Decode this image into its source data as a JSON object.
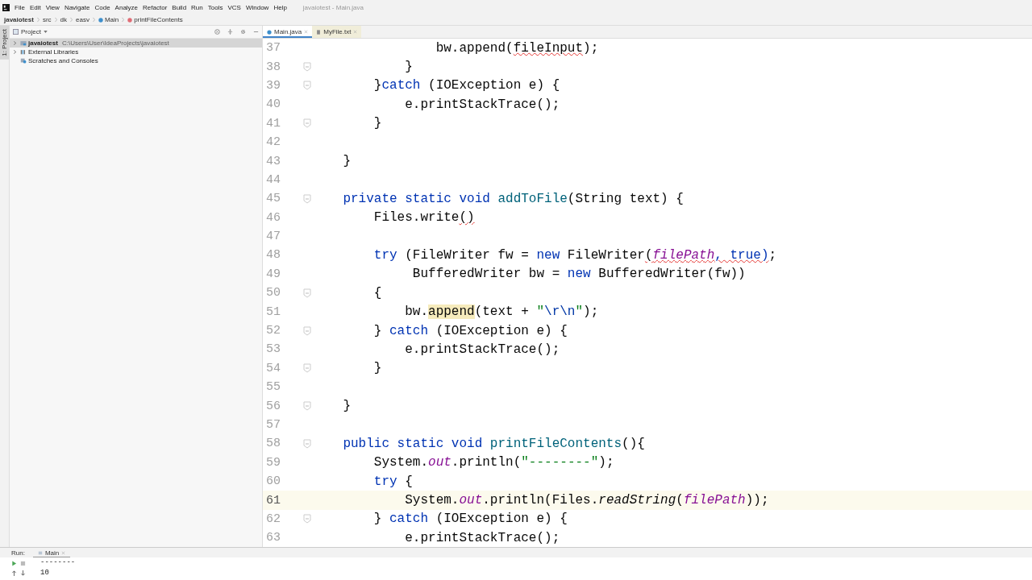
{
  "menu_bar": {
    "items": [
      "File",
      "Edit",
      "View",
      "Navigate",
      "Code",
      "Analyze",
      "Refactor",
      "Build",
      "Run",
      "Tools",
      "VCS",
      "Window",
      "Help"
    ],
    "title": "javaiotest - Main.java"
  },
  "breadcrumbs": [
    {
      "label": "javaiotest",
      "kind": "project"
    },
    {
      "label": "src",
      "kind": "folder"
    },
    {
      "label": "dk",
      "kind": "folder"
    },
    {
      "label": "easv",
      "kind": "folder"
    },
    {
      "label": "Main",
      "kind": "class"
    },
    {
      "label": "printFileContents",
      "kind": "method"
    }
  ],
  "tool_stripe": {
    "label": "1: Project"
  },
  "project_panel": {
    "title": "Project",
    "tree": [
      {
        "label": "javaiotest",
        "path": "C:\\Users\\User\\IdeaProjects\\javaiotest",
        "kind": "module",
        "expanded": false,
        "selected": true
      },
      {
        "label": "External Libraries",
        "kind": "library",
        "expanded": false,
        "selected": false
      },
      {
        "label": "Scratches and Consoles",
        "kind": "scratch",
        "selected": false
      }
    ]
  },
  "editor_tabs": [
    {
      "label": "Main.java",
      "kind": "java",
      "selected": true
    },
    {
      "label": "MyFile.txt",
      "kind": "text",
      "selected": false
    }
  ],
  "editor": {
    "lines": [
      {
        "number": "37",
        "fold": false,
        "current": false,
        "segments": [
          {
            "text": "                bw.append(",
            "kind": "plain"
          },
          {
            "text": "fileInput",
            "kind": "error"
          },
          {
            "text": ");",
            "kind": "plain"
          }
        ]
      },
      {
        "number": "38",
        "fold": true,
        "current": false,
        "segments": [
          {
            "text": "            }",
            "kind": "plain"
          }
        ]
      },
      {
        "number": "39",
        "fold": true,
        "current": false,
        "segments": [
          {
            "text": "        }",
            "kind": "plain"
          },
          {
            "text": "catch",
            "kind": "kw"
          },
          {
            "text": " (IOException e) {",
            "kind": "plain"
          }
        ]
      },
      {
        "number": "40",
        "fold": false,
        "current": false,
        "segments": [
          {
            "text": "            e.printStackTrace();",
            "kind": "plain"
          }
        ]
      },
      {
        "number": "41",
        "fold": true,
        "current": false,
        "segments": [
          {
            "text": "        }",
            "kind": "plain"
          }
        ]
      },
      {
        "number": "42",
        "fold": false,
        "current": false
      },
      {
        "number": "43",
        "fold": false,
        "current": false,
        "segments": [
          {
            "text": "    }",
            "kind": "plain"
          }
        ]
      },
      {
        "number": "44",
        "fold": false,
        "current": false
      },
      {
        "number": "45",
        "fold": true,
        "current": false,
        "segments": [
          {
            "text": "    private static void ",
            "kind": "kw"
          },
          {
            "text": "addToFile",
            "kind": "decl"
          },
          {
            "text": "(String text) {",
            "kind": "plain"
          }
        ]
      },
      {
        "number": "46",
        "fold": false,
        "current": false,
        "segments": [
          {
            "text": "        Files.write",
            "kind": "plain"
          },
          {
            "text": "()",
            "kind": "error"
          }
        ]
      },
      {
        "number": "47",
        "fold": false,
        "current": false
      },
      {
        "number": "48",
        "fold": false,
        "current": false,
        "segments": [
          {
            "text": "        try",
            "kind": "kw"
          },
          {
            "text": " (FileWriter fw = ",
            "kind": "plain"
          },
          {
            "text": "new",
            "kind": "kw"
          },
          {
            "text": " FileWriter",
            "kind": "plain"
          },
          {
            "text": "(",
            "kind": "error"
          },
          {
            "text": "filePath",
            "kind": "error-field"
          },
          {
            "text": ", true)",
            "kind": "error-kw"
          },
          {
            "text": ";",
            "kind": "plain"
          }
        ]
      },
      {
        "number": "49",
        "fold": false,
        "current": false,
        "segments": [
          {
            "text": "             BufferedWriter bw = ",
            "kind": "plain"
          },
          {
            "text": "new",
            "kind": "kw"
          },
          {
            "text": " BufferedWriter(fw))",
            "kind": "plain"
          }
        ]
      },
      {
        "number": "50",
        "fold": true,
        "current": false,
        "segments": [
          {
            "text": "        {",
            "kind": "plain"
          }
        ]
      },
      {
        "number": "51",
        "fold": false,
        "current": false,
        "segments": [
          {
            "text": "            bw.",
            "kind": "plain"
          },
          {
            "text": "append",
            "kind": "usage"
          },
          {
            "text": "(text + ",
            "kind": "plain"
          },
          {
            "text": "\"",
            "kind": "str"
          },
          {
            "text": "\\r\\n",
            "kind": "escape"
          },
          {
            "text": "\"",
            "kind": "str"
          },
          {
            "text": ");",
            "kind": "plain"
          }
        ]
      },
      {
        "number": "52",
        "fold": true,
        "current": false,
        "segments": [
          {
            "text": "        } ",
            "kind": "plain"
          },
          {
            "text": "catch",
            "kind": "kw"
          },
          {
            "text": " (IOException e) {",
            "kind": "plain"
          }
        ]
      },
      {
        "number": "53",
        "fold": false,
        "current": false,
        "segments": [
          {
            "text": "            e.printStackTrace();",
            "kind": "plain"
          }
        ]
      },
      {
        "number": "54",
        "fold": true,
        "current": false,
        "segments": [
          {
            "text": "        }",
            "kind": "plain"
          }
        ]
      },
      {
        "number": "55",
        "fold": false,
        "current": false
      },
      {
        "number": "56",
        "fold": true,
        "current": false,
        "segments": [
          {
            "text": "    }",
            "kind": "plain"
          }
        ]
      },
      {
        "number": "57",
        "fold": false,
        "current": false
      },
      {
        "number": "58",
        "fold": true,
        "current": false,
        "segments": [
          {
            "text": "    public static void ",
            "kind": "kw"
          },
          {
            "text": "printFileContents",
            "kind": "decl"
          },
          {
            "text": "(){",
            "kind": "plain"
          }
        ]
      },
      {
        "number": "59",
        "fold": false,
        "current": false,
        "segments": [
          {
            "text": "        System.",
            "kind": "plain"
          },
          {
            "text": "out",
            "kind": "field"
          },
          {
            "text": ".println(",
            "kind": "plain"
          },
          {
            "text": "\"--------\"",
            "kind": "str"
          },
          {
            "text": ");",
            "kind": "plain"
          }
        ]
      },
      {
        "number": "60",
        "fold": false,
        "current": false,
        "segments": [
          {
            "text": "        try",
            "kind": "kw"
          },
          {
            "text": " {",
            "kind": "plain"
          }
        ]
      },
      {
        "number": "61",
        "fold": false,
        "current": true,
        "segments": [
          {
            "text": "            System.",
            "kind": "plain"
          },
          {
            "text": "out",
            "kind": "field"
          },
          {
            "text": ".println(Files.",
            "kind": "plain"
          },
          {
            "text": "readString",
            "kind": "static"
          },
          {
            "text": "(",
            "kind": "plain"
          },
          {
            "text": "filePath",
            "kind": "field"
          },
          {
            "text": "));",
            "kind": "plain"
          }
        ]
      },
      {
        "number": "62",
        "fold": true,
        "current": false,
        "segments": [
          {
            "text": "        } ",
            "kind": "plain"
          },
          {
            "text": "catch",
            "kind": "kw"
          },
          {
            "text": " (IOException e) {",
            "kind": "plain"
          }
        ]
      },
      {
        "number": "63",
        "fold": false,
        "current": false,
        "segments": [
          {
            "text": "            e.printStackTrace();",
            "kind": "plain"
          }
        ]
      }
    ]
  },
  "run_panel": {
    "label": "Run:",
    "tab": "Main",
    "output": [
      "--------",
      "10"
    ]
  }
}
